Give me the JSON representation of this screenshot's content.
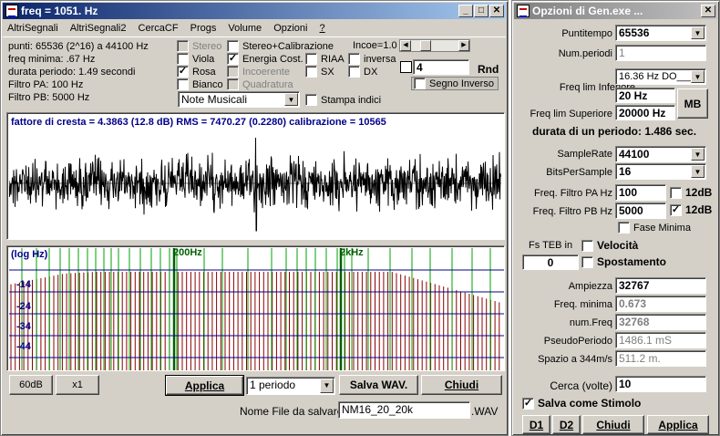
{
  "main_window": {
    "title": "freq = 1051. Hz",
    "menu": [
      "AltriSegnali",
      "AltriSegnali2",
      "CercaCF",
      "Progs",
      "Volume",
      "Opzioni",
      "?"
    ],
    "info": [
      "punti: 65536 (2^16) a 44100 Hz",
      "freq minima: .67 Hz",
      "durata periodo: 1.49 secondi",
      "Filtro PA: 100 Hz",
      "Filtro PB: 5000 Hz"
    ],
    "checks": {
      "stereo": {
        "label": "Stereo",
        "checked": false
      },
      "stereo_cal": {
        "label": "Stereo+Calibrazione",
        "checked": false
      },
      "viola": {
        "label": "Viola",
        "checked": false
      },
      "energia": {
        "label": "Energia Cost.",
        "checked": true
      },
      "riaa": {
        "label": "RIAA",
        "checked": false
      },
      "inversa": {
        "label": "inversa",
        "checked": false
      },
      "rosa": {
        "label": "Rosa",
        "checked": true
      },
      "incoerente": {
        "label": "Incoerente",
        "checked": false
      },
      "sx": {
        "label": "SX",
        "checked": false
      },
      "dx": {
        "label": "DX",
        "checked": false
      },
      "bianco": {
        "label": "Bianco",
        "checked": false
      },
      "quadratura": {
        "label": "Quadratura",
        "checked": false
      },
      "stampa": {
        "label": "Stampa indici",
        "checked": false
      },
      "segno": {
        "label": "Segno Inverso",
        "checked": false
      }
    },
    "incoe_label": "Incoe=1.0",
    "rnd_value": "4",
    "rnd_label": "Rnd",
    "note_select": "Note Musicali",
    "stats": "fattore di cresta = 4.3863 (12.8 dB) RMS = 7470.27 (0.2280)  calibrazione = 10565",
    "spectrum": {
      "y_label": "(log Hz)",
      "marker1": "200Hz",
      "marker2": "2kHz",
      "levels": [
        "-14",
        "-24",
        "-34",
        "-44"
      ]
    },
    "buttons": {
      "b60": "60dB",
      "x1": "x1",
      "applica": "Applica",
      "salva": "Salva WAV.",
      "chiudi": "Chiudi"
    },
    "periodo_select": "1 periodo",
    "nome_label": "Nome File da salvare",
    "filename": "NM16_20_20k",
    "ext": ".WAV"
  },
  "options_window": {
    "title": "Opzioni di Gen.exe ...",
    "puntitempo_label": "Puntitempo",
    "puntitempo": "65536",
    "numperiodi_label": "Num.periodi",
    "numperiodi": "1",
    "freq_inf_label": "Freq lim Inferiore",
    "freq_preset": "16.36 Hz DO___",
    "freq_inf": "20 Hz",
    "freq_sup_label": "Freq lim Superiore",
    "freq_sup": "20000 Hz",
    "mb": "MB",
    "durata": "durata di un periodo: 1.486 sec.",
    "samplerate_label": "SampleRate",
    "samplerate": "44100",
    "bps_label": "BitsPerSample",
    "bps": "16",
    "pa_label": "Freq. Filtro PA Hz",
    "pa": "100",
    "pa_12": "12dB",
    "pb_label": "Freq. Filtro PB Hz",
    "pb": "5000",
    "pb_12": "12dB",
    "fase": "Fase Minima",
    "fsteb": "Fs TEB  in",
    "velocita": "Velocità",
    "spost_val": "0",
    "spostamento": "Spostamento",
    "ampiezza_label": "Ampiezza",
    "ampiezza": "32767",
    "fmin_label": "Freq. minima",
    "fmin": "0.673",
    "numfreq_label": "num.Freq",
    "numfreq": "32768",
    "pseudo_label": "PseudoPeriodo",
    "pseudo": "1486.1 mS",
    "spazio_label": "Spazio a 344m/s",
    "spazio": "511.2 m.",
    "cerca_label": "Cerca (volte)",
    "cerca": "10",
    "salva_stimolo": "Salva come Stimolo",
    "d1": "D1",
    "d2": "D2",
    "chiudi": "Chiudi",
    "applica": "Applica"
  },
  "colors": {
    "title_active": "#0a246a",
    "plot_blue": "#00008b",
    "green_marker": "#00a000",
    "spectrum_red": "#8b0000"
  }
}
